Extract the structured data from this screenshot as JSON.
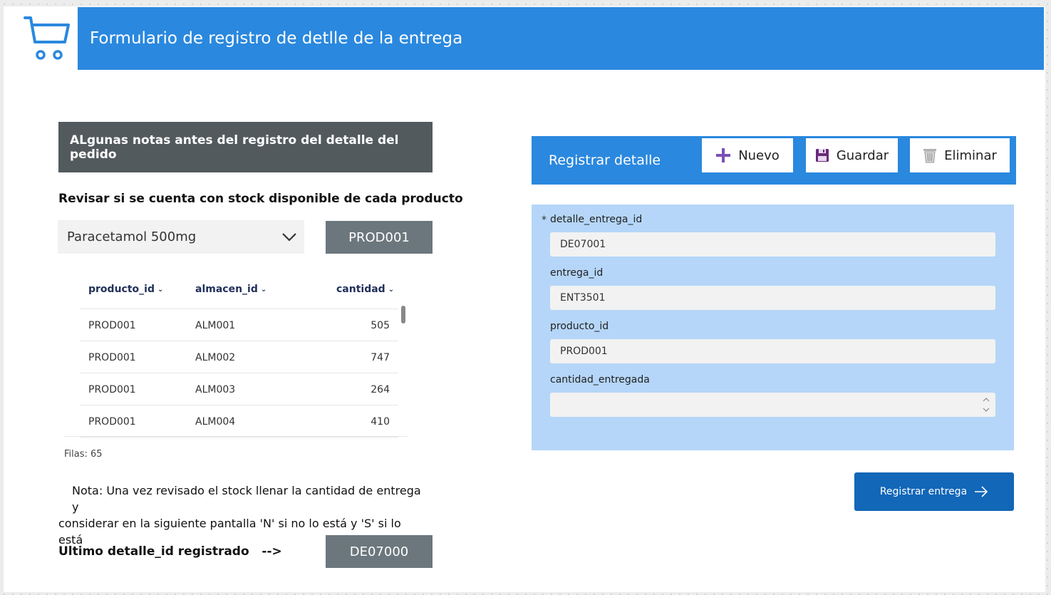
{
  "header": {
    "title": "Formulario de registro de detlle de la entrega",
    "icon": "shopping-cart-icon"
  },
  "notes": {
    "title": "ALgunas notas antes del registro del detalle del pedido",
    "stock_label": "Revisar si se cuenta con stock disponible de cada producto",
    "product_select_value": "Paracetamol 500mg",
    "product_code": "PROD001",
    "grid": {
      "columns": [
        "producto_id",
        "almacen_id",
        "cantidad"
      ],
      "rows": [
        [
          "PROD001",
          "ALM001",
          "505"
        ],
        [
          "PROD001",
          "ALM002",
          "747"
        ],
        [
          "PROD001",
          "ALM003",
          "264"
        ],
        [
          "PROD001",
          "ALM004",
          "410"
        ]
      ]
    },
    "filas": "Filas: 65",
    "nota_line1": "Nota: Una vez revisado el stock llenar la cantidad de entrega y",
    "nota_line2": "considerar en la siguiente pantalla 'N' si no lo está y 'S' si lo está",
    "ultimo_label": "Ultimo detalle_id registrado   -->",
    "ultimo_value": "DE07000"
  },
  "register": {
    "title": "Registrar detalle",
    "buttons": {
      "nuevo": "Nuevo",
      "guardar": "Guardar",
      "eliminar": "Eliminar"
    },
    "required_mark": "*",
    "fields": [
      {
        "label": "detalle_entrega_id",
        "value": "DE07001"
      },
      {
        "label": "entrega_id",
        "value": "ENT3501"
      },
      {
        "label": "producto_id",
        "value": "PROD001"
      },
      {
        "label": "cantidad_entregada",
        "value": ""
      }
    ],
    "submit_label": "Registrar entrega"
  },
  "colors": {
    "header_blue": "#2a88de",
    "panel_blue": "#b5d6f8",
    "dark_gray": "#535a5e",
    "slate": "#6b777d",
    "submit_blue": "#1267b8"
  }
}
